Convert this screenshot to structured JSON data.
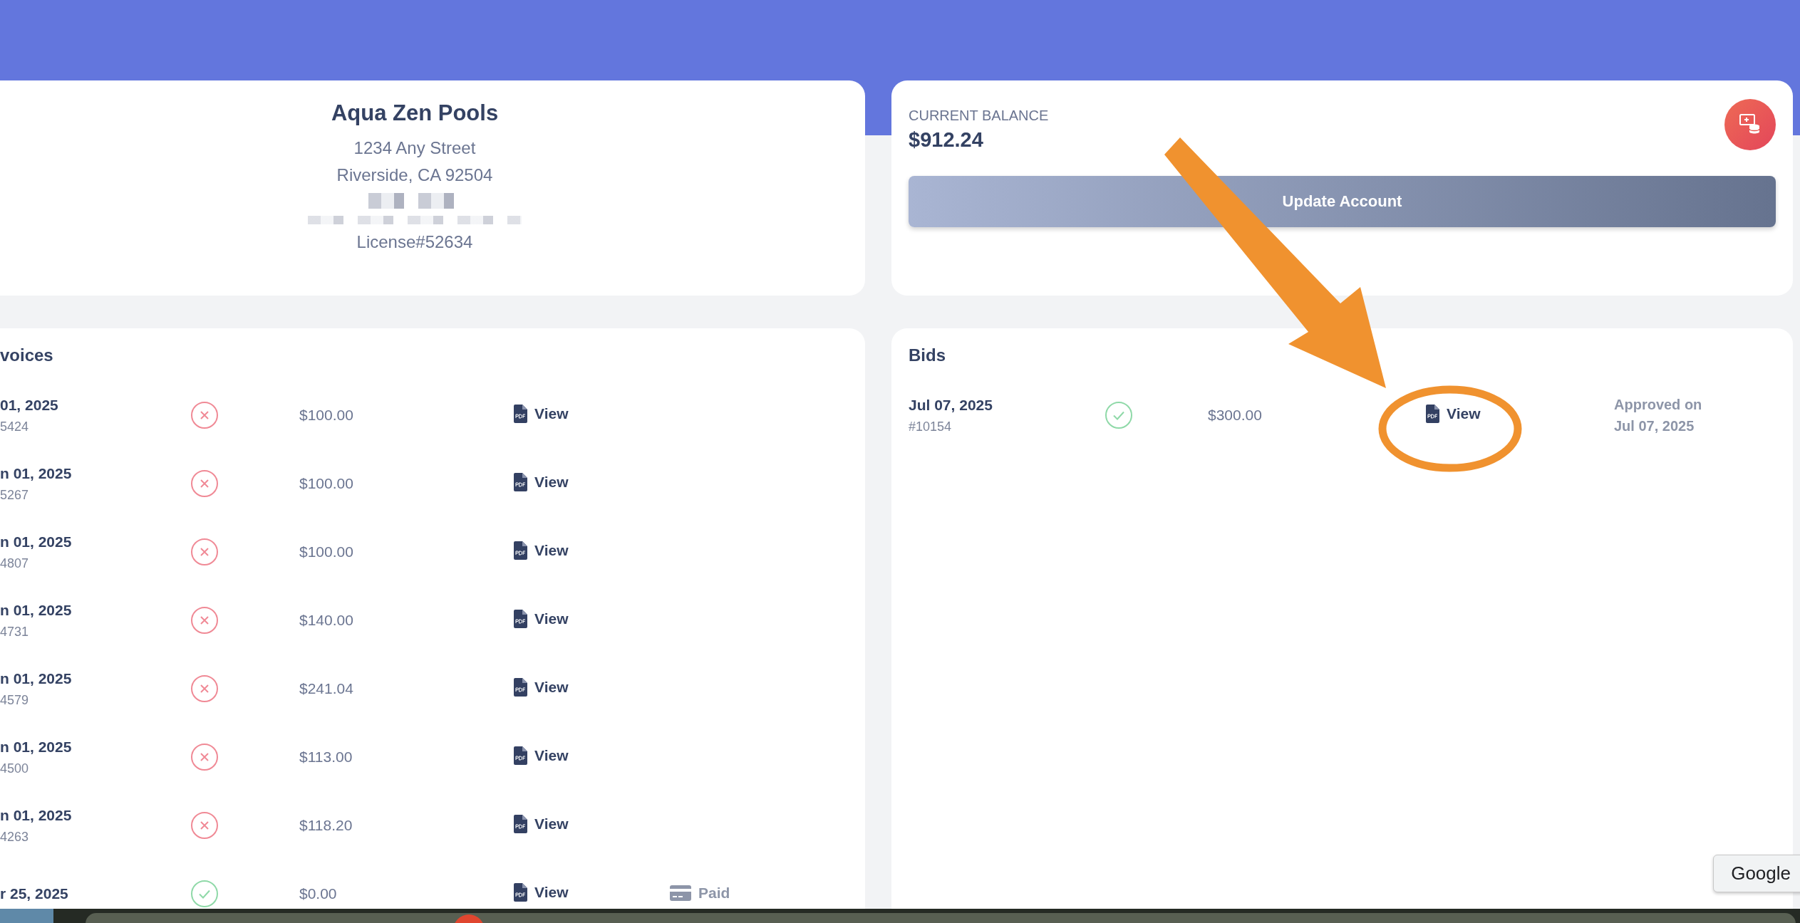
{
  "company": {
    "name": "Aqua Zen Pools",
    "address_lines": [
      "1234 Any Street",
      "Riverside, CA 92504"
    ],
    "license": "License#52634"
  },
  "balance": {
    "label": "CURRENT BALANCE",
    "amount": "$912.24",
    "button": "Update Account"
  },
  "invoices": {
    "title": "voices",
    "rows": [
      {
        "date": "01, 2025",
        "number": "5424",
        "paid": false,
        "amount": "$100.00",
        "view": "View"
      },
      {
        "date": "n 01, 2025",
        "number": "5267",
        "paid": false,
        "amount": "$100.00",
        "view": "View"
      },
      {
        "date": "n 01, 2025",
        "number": "4807",
        "paid": false,
        "amount": "$100.00",
        "view": "View"
      },
      {
        "date": "n 01, 2025",
        "number": "4731",
        "paid": false,
        "amount": "$140.00",
        "view": "View"
      },
      {
        "date": "n 01, 2025",
        "number": "4579",
        "paid": false,
        "amount": "$241.04",
        "view": "View"
      },
      {
        "date": "n 01, 2025",
        "number": "4500",
        "paid": false,
        "amount": "$113.00",
        "view": "View"
      },
      {
        "date": "n 01, 2025",
        "number": "4263",
        "paid": false,
        "amount": "$118.20",
        "view": "View"
      },
      {
        "date": "r 25, 2025",
        "paid": true,
        "amount": "$0.00",
        "view": "View",
        "payment": "Paid"
      }
    ]
  },
  "bids": {
    "title": "Bids",
    "rows": [
      {
        "date": "Jul 07, 2025",
        "number": "#10154",
        "paid": true,
        "amount": "$300.00",
        "view": "View",
        "approval": [
          "Approved on",
          "Jul 07, 2025"
        ]
      }
    ]
  },
  "tooltip": "Google"
}
